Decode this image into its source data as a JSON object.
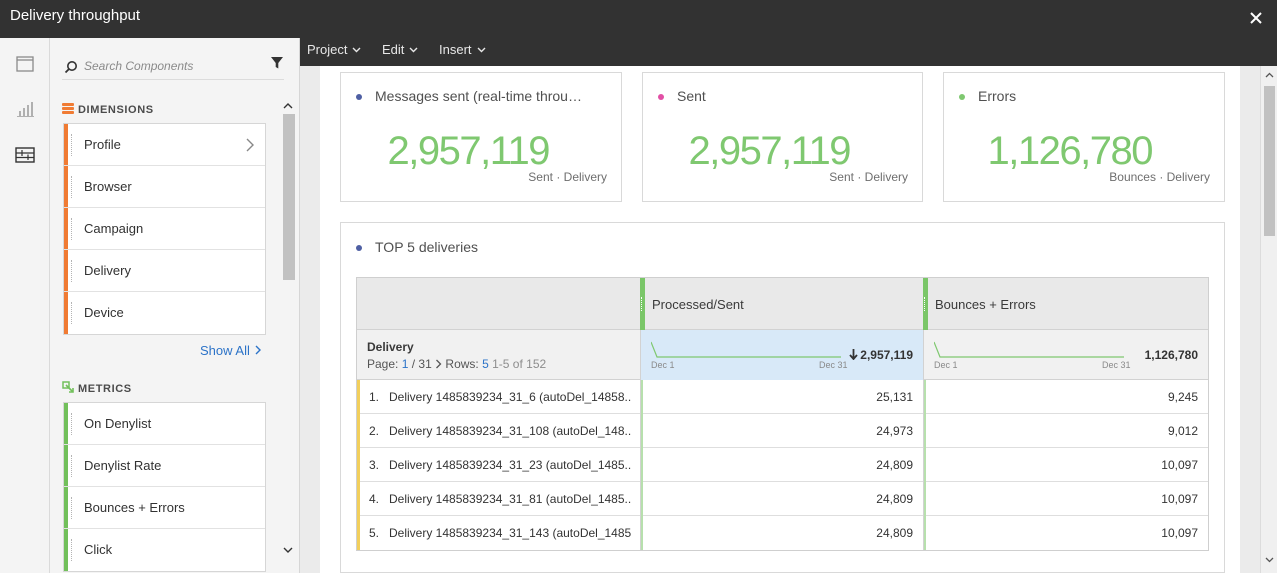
{
  "window": {
    "title": "Delivery throughput"
  },
  "menu": {
    "project": "Project",
    "edit": "Edit",
    "insert": "Insert"
  },
  "search": {
    "placeholder": "Search Components"
  },
  "dimensions": {
    "heading": "DIMENSIONS",
    "items": [
      {
        "label": "Profile",
        "has_chevron": true
      },
      {
        "label": "Browser"
      },
      {
        "label": "Campaign"
      },
      {
        "label": "Delivery"
      },
      {
        "label": "Device"
      }
    ],
    "show_all": "Show All"
  },
  "metrics": {
    "heading": "METRICS",
    "items": [
      {
        "label": "On Denylist"
      },
      {
        "label": "Denylist Rate"
      },
      {
        "label": "Bounces + Errors"
      },
      {
        "label": "Click"
      }
    ]
  },
  "cards": [
    {
      "label": "Messages sent (real-time throug...",
      "value": "2,957,119",
      "sub": "Sent · Delivery",
      "dot_color": "#4e5fa3"
    },
    {
      "label": "Sent",
      "value": "2,957,119",
      "sub": "Sent · Delivery",
      "dot_color": "#e24fa5"
    },
    {
      "label": "Errors",
      "value": "1,126,780",
      "sub": "Bounces · Delivery",
      "dot_color": "#7fc870"
    }
  ],
  "freeform": {
    "title": "TOP 5 deliveries",
    "columns": [
      {
        "label": "Processed/Sent",
        "total": "2,957,119",
        "date_start": "Dec 1",
        "date_end": "Dec 31"
      },
      {
        "label": "Bounces + Errors",
        "total": "1,126,780",
        "date_start": "Dec 1",
        "date_end": "Dec 31"
      }
    ],
    "dimension": "Delivery",
    "pager": {
      "prefix": "Page: ",
      "current": "1",
      "sep": " / 31",
      "rows_label": " Rows: ",
      "rows": "5",
      "range": " 1-5 of 152"
    },
    "rows": [
      {
        "num": "1.",
        "name": "Delivery 1485839234_31_6 (autoDel_14858...",
        "v1": "25,131",
        "v2": "9,245"
      },
      {
        "num": "2.",
        "name": "Delivery 1485839234_31_108 (autoDel_148...",
        "v1": "24,973",
        "v2": "9,012"
      },
      {
        "num": "3.",
        "name": "Delivery 1485839234_31_23 (autoDel_1485...",
        "v1": "24,809",
        "v2": "10,097"
      },
      {
        "num": "4.",
        "name": "Delivery 1485839234_31_81 (autoDel_1485...",
        "v1": "24,809",
        "v2": "10,097"
      },
      {
        "num": "5.",
        "name": "Delivery 1485839234_31_143 (autoDel_1485...",
        "v1": "24,809",
        "v2": "10,097"
      }
    ]
  },
  "colors": {
    "accent_green": "#7fc870",
    "dimension_orange": "#f07b33",
    "metric_green": "#72c05b",
    "link_blue": "#2c73c8"
  }
}
